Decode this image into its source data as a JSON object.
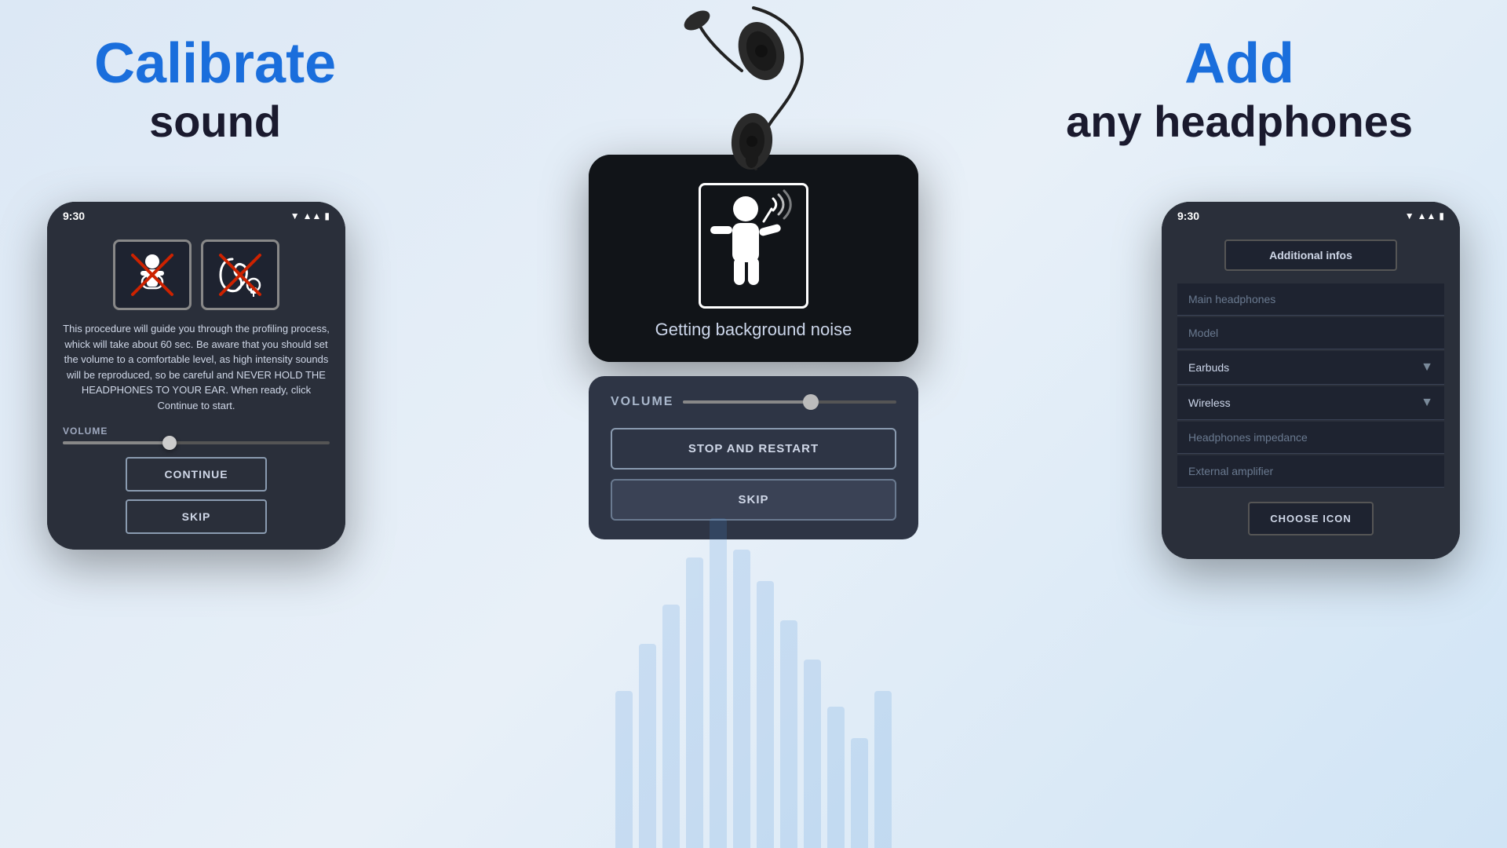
{
  "header": {
    "left": {
      "calibrate": "Calibrate",
      "sound": "sound"
    },
    "right": {
      "add": "Add",
      "any_headphones": "any headphones"
    }
  },
  "left_phone": {
    "status_time": "9:30",
    "warning_text": "This procedure will guide you through the profiling process, whick will take about 60 sec.\nBe aware that you should set the volume to a comfortable level, as high intensity sounds will be reproduced, so be careful and NEVER HOLD THE HEADPHONES TO YOUR EAR.\nWhen ready, click Continue to start.",
    "volume_label": "VOLUME",
    "volume_percent": 40,
    "continue_label": "CONTINUE",
    "skip_label": "SKIP"
  },
  "center_phone": {
    "getting_bg_noise": "Getting background noise",
    "volume_label": "VOLUME",
    "volume_percent": 60,
    "stop_restart_label": "STOP AND RESTART",
    "skip_label": "SKIP"
  },
  "right_phone": {
    "status_time": "9:30",
    "additional_infos_label": "Additional infos",
    "main_headphones_placeholder": "Main headphones",
    "model_placeholder": "Model",
    "earbuds_label": "Earbuds",
    "wireless_label": "Wireless",
    "headphones_impedance_placeholder": "Headphones impedance",
    "external_amplifier_placeholder": "External amplifier",
    "choose_icon_label": "CHOOSE ICON"
  }
}
